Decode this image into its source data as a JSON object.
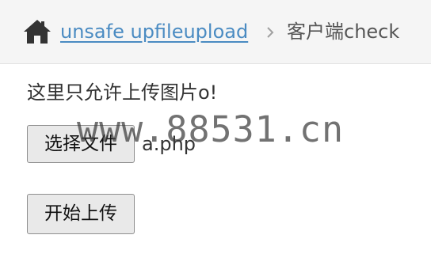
{
  "breadcrumb": {
    "home_icon": "home-icon",
    "link_label": "unsafe upfileupload",
    "separator_icon": "chevron-right-icon",
    "current_label": "客户端check"
  },
  "main": {
    "hint_text": "这里只允许上传图片o!",
    "choose_file_label": "选择文件",
    "selected_file": "a.php",
    "upload_label": "开始上传"
  },
  "watermark": {
    "text": "www.88531.cn"
  },
  "colors": {
    "link": "#4a8bc2",
    "breadcrumb_bg": "#f5f5f5",
    "button_bg": "#e9e9e9"
  }
}
